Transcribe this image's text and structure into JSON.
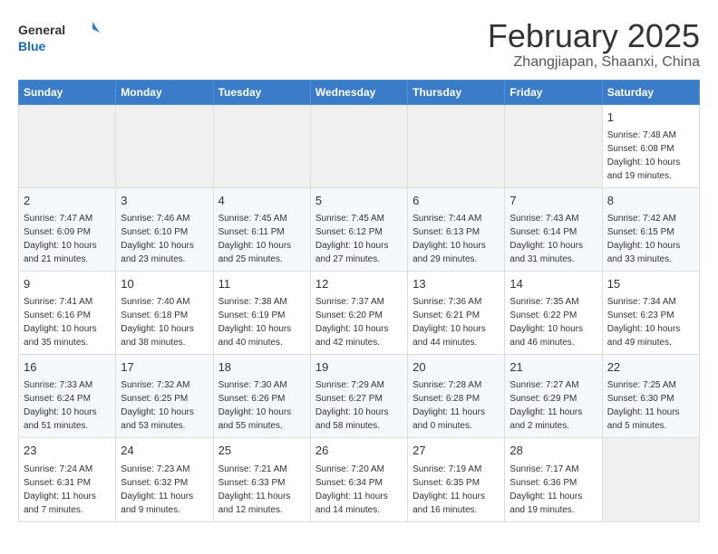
{
  "logo": {
    "line1": "General",
    "line2": "Blue"
  },
  "title": "February 2025",
  "subtitle": "Zhangjiapan, Shaanxi, China",
  "weekdays": [
    "Sunday",
    "Monday",
    "Tuesday",
    "Wednesday",
    "Thursday",
    "Friday",
    "Saturday"
  ],
  "weeks": [
    [
      {
        "day": "",
        "info": ""
      },
      {
        "day": "",
        "info": ""
      },
      {
        "day": "",
        "info": ""
      },
      {
        "day": "",
        "info": ""
      },
      {
        "day": "",
        "info": ""
      },
      {
        "day": "",
        "info": ""
      },
      {
        "day": "1",
        "info": "Sunrise: 7:48 AM\nSunset: 6:08 PM\nDaylight: 10 hours and 19 minutes."
      }
    ],
    [
      {
        "day": "2",
        "info": "Sunrise: 7:47 AM\nSunset: 6:09 PM\nDaylight: 10 hours and 21 minutes."
      },
      {
        "day": "3",
        "info": "Sunrise: 7:46 AM\nSunset: 6:10 PM\nDaylight: 10 hours and 23 minutes."
      },
      {
        "day": "4",
        "info": "Sunrise: 7:45 AM\nSunset: 6:11 PM\nDaylight: 10 hours and 25 minutes."
      },
      {
        "day": "5",
        "info": "Sunrise: 7:45 AM\nSunset: 6:12 PM\nDaylight: 10 hours and 27 minutes."
      },
      {
        "day": "6",
        "info": "Sunrise: 7:44 AM\nSunset: 6:13 PM\nDaylight: 10 hours and 29 minutes."
      },
      {
        "day": "7",
        "info": "Sunrise: 7:43 AM\nSunset: 6:14 PM\nDaylight: 10 hours and 31 minutes."
      },
      {
        "day": "8",
        "info": "Sunrise: 7:42 AM\nSunset: 6:15 PM\nDaylight: 10 hours and 33 minutes."
      }
    ],
    [
      {
        "day": "9",
        "info": "Sunrise: 7:41 AM\nSunset: 6:16 PM\nDaylight: 10 hours and 35 minutes."
      },
      {
        "day": "10",
        "info": "Sunrise: 7:40 AM\nSunset: 6:18 PM\nDaylight: 10 hours and 38 minutes."
      },
      {
        "day": "11",
        "info": "Sunrise: 7:38 AM\nSunset: 6:19 PM\nDaylight: 10 hours and 40 minutes."
      },
      {
        "day": "12",
        "info": "Sunrise: 7:37 AM\nSunset: 6:20 PM\nDaylight: 10 hours and 42 minutes."
      },
      {
        "day": "13",
        "info": "Sunrise: 7:36 AM\nSunset: 6:21 PM\nDaylight: 10 hours and 44 minutes."
      },
      {
        "day": "14",
        "info": "Sunrise: 7:35 AM\nSunset: 6:22 PM\nDaylight: 10 hours and 46 minutes."
      },
      {
        "day": "15",
        "info": "Sunrise: 7:34 AM\nSunset: 6:23 PM\nDaylight: 10 hours and 49 minutes."
      }
    ],
    [
      {
        "day": "16",
        "info": "Sunrise: 7:33 AM\nSunset: 6:24 PM\nDaylight: 10 hours and 51 minutes."
      },
      {
        "day": "17",
        "info": "Sunrise: 7:32 AM\nSunset: 6:25 PM\nDaylight: 10 hours and 53 minutes."
      },
      {
        "day": "18",
        "info": "Sunrise: 7:30 AM\nSunset: 6:26 PM\nDaylight: 10 hours and 55 minutes."
      },
      {
        "day": "19",
        "info": "Sunrise: 7:29 AM\nSunset: 6:27 PM\nDaylight: 10 hours and 58 minutes."
      },
      {
        "day": "20",
        "info": "Sunrise: 7:28 AM\nSunset: 6:28 PM\nDaylight: 11 hours and 0 minutes."
      },
      {
        "day": "21",
        "info": "Sunrise: 7:27 AM\nSunset: 6:29 PM\nDaylight: 11 hours and 2 minutes."
      },
      {
        "day": "22",
        "info": "Sunrise: 7:25 AM\nSunset: 6:30 PM\nDaylight: 11 hours and 5 minutes."
      }
    ],
    [
      {
        "day": "23",
        "info": "Sunrise: 7:24 AM\nSunset: 6:31 PM\nDaylight: 11 hours and 7 minutes."
      },
      {
        "day": "24",
        "info": "Sunrise: 7:23 AM\nSunset: 6:32 PM\nDaylight: 11 hours and 9 minutes."
      },
      {
        "day": "25",
        "info": "Sunrise: 7:21 AM\nSunset: 6:33 PM\nDaylight: 11 hours and 12 minutes."
      },
      {
        "day": "26",
        "info": "Sunrise: 7:20 AM\nSunset: 6:34 PM\nDaylight: 11 hours and 14 minutes."
      },
      {
        "day": "27",
        "info": "Sunrise: 7:19 AM\nSunset: 6:35 PM\nDaylight: 11 hours and 16 minutes."
      },
      {
        "day": "28",
        "info": "Sunrise: 7:17 AM\nSunset: 6:36 PM\nDaylight: 11 hours and 19 minutes."
      },
      {
        "day": "",
        "info": ""
      }
    ]
  ]
}
